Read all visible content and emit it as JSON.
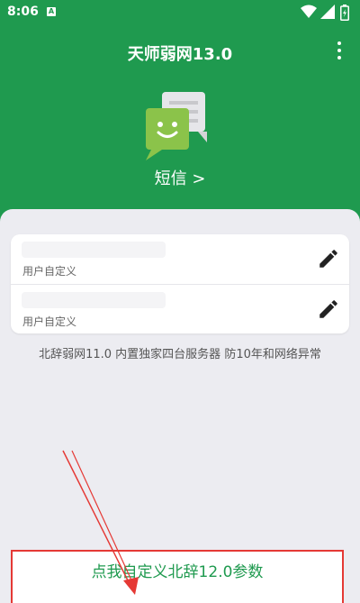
{
  "status_bar": {
    "time": "8:06",
    "a_badge": "A"
  },
  "app": {
    "title": "天师弱网13.0",
    "menu_icon": "more-vert-icon"
  },
  "hero": {
    "label": "短信 >",
    "icon": "sms-face-icon"
  },
  "card": {
    "rows": [
      {
        "hint": "用户自定义",
        "icon": "edit-icon"
      },
      {
        "hint": "用户自定义",
        "icon": "edit-icon"
      }
    ]
  },
  "info": "北辞弱网11.0 内置独家四台服务器 防10年和网络异常",
  "bottom": {
    "label": "点我自定义北辞12.0参数"
  },
  "colors": {
    "primary": "#1f9a4f",
    "annotation": "#e53935",
    "background": "#ececf1"
  }
}
